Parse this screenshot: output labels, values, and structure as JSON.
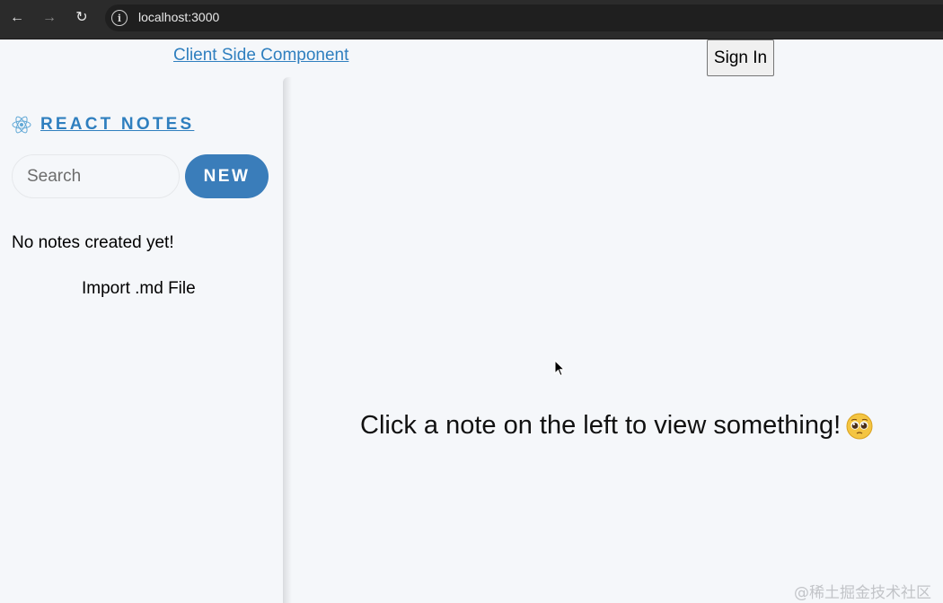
{
  "browser": {
    "back_icon": "←",
    "forward_icon": "→",
    "reload_icon": "↻",
    "info_icon": "i",
    "url": "localhost:3000"
  },
  "header": {
    "client_link": "Client Side Component",
    "sign_in": "Sign In"
  },
  "sidebar": {
    "brand": "REACT NOTES",
    "search_placeholder": "Search",
    "new_button": "NEW",
    "empty_message": "No notes created yet!",
    "import_label": "Import .md File"
  },
  "main": {
    "placeholder": "Click a note on the left to view something!"
  },
  "watermark": "@稀土掘金技术社区",
  "colors": {
    "accent": "#3a7dba",
    "link": "#2f7fbf",
    "background": "#f5f7fa",
    "browser_bar": "#2b2b2b"
  }
}
